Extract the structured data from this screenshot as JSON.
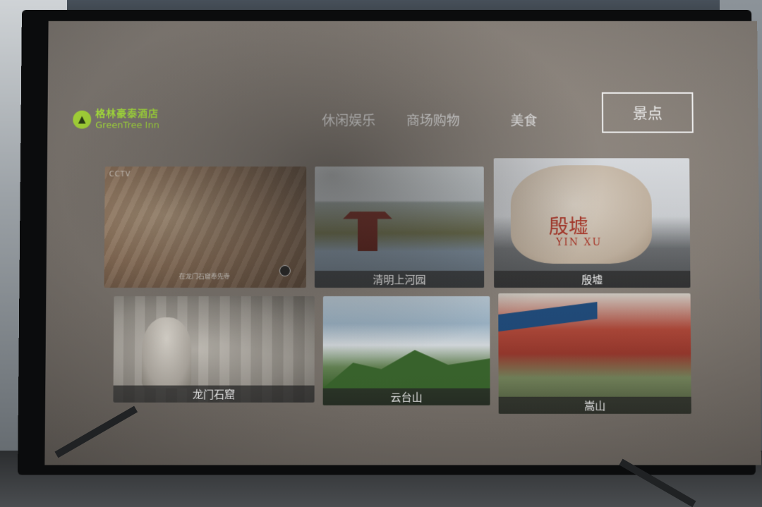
{
  "logo": {
    "brand_cn": "格林豪泰酒店",
    "brand_en": "GreenTree Inn",
    "icon": "tree-icon"
  },
  "nav": {
    "items": [
      {
        "label": "休闲娱乐"
      },
      {
        "label": "商场购物"
      },
      {
        "label": "美食"
      },
      {
        "label": "景点",
        "active": true
      }
    ]
  },
  "tiles": [
    {
      "caption": "",
      "watermark": "CCTV",
      "subtitle": "在龙门石窟奉先寺"
    },
    {
      "caption": "清明上河园"
    },
    {
      "caption": "殷墟",
      "stone_text": "殷墟",
      "stone_latin": "YIN XU"
    },
    {
      "caption": "龙门石窟"
    },
    {
      "caption": "云台山"
    },
    {
      "caption": "嵩山"
    }
  ],
  "colors": {
    "brand_green": "#a6e335",
    "caption_bg": "#282828",
    "stone_red": "#b13324"
  }
}
